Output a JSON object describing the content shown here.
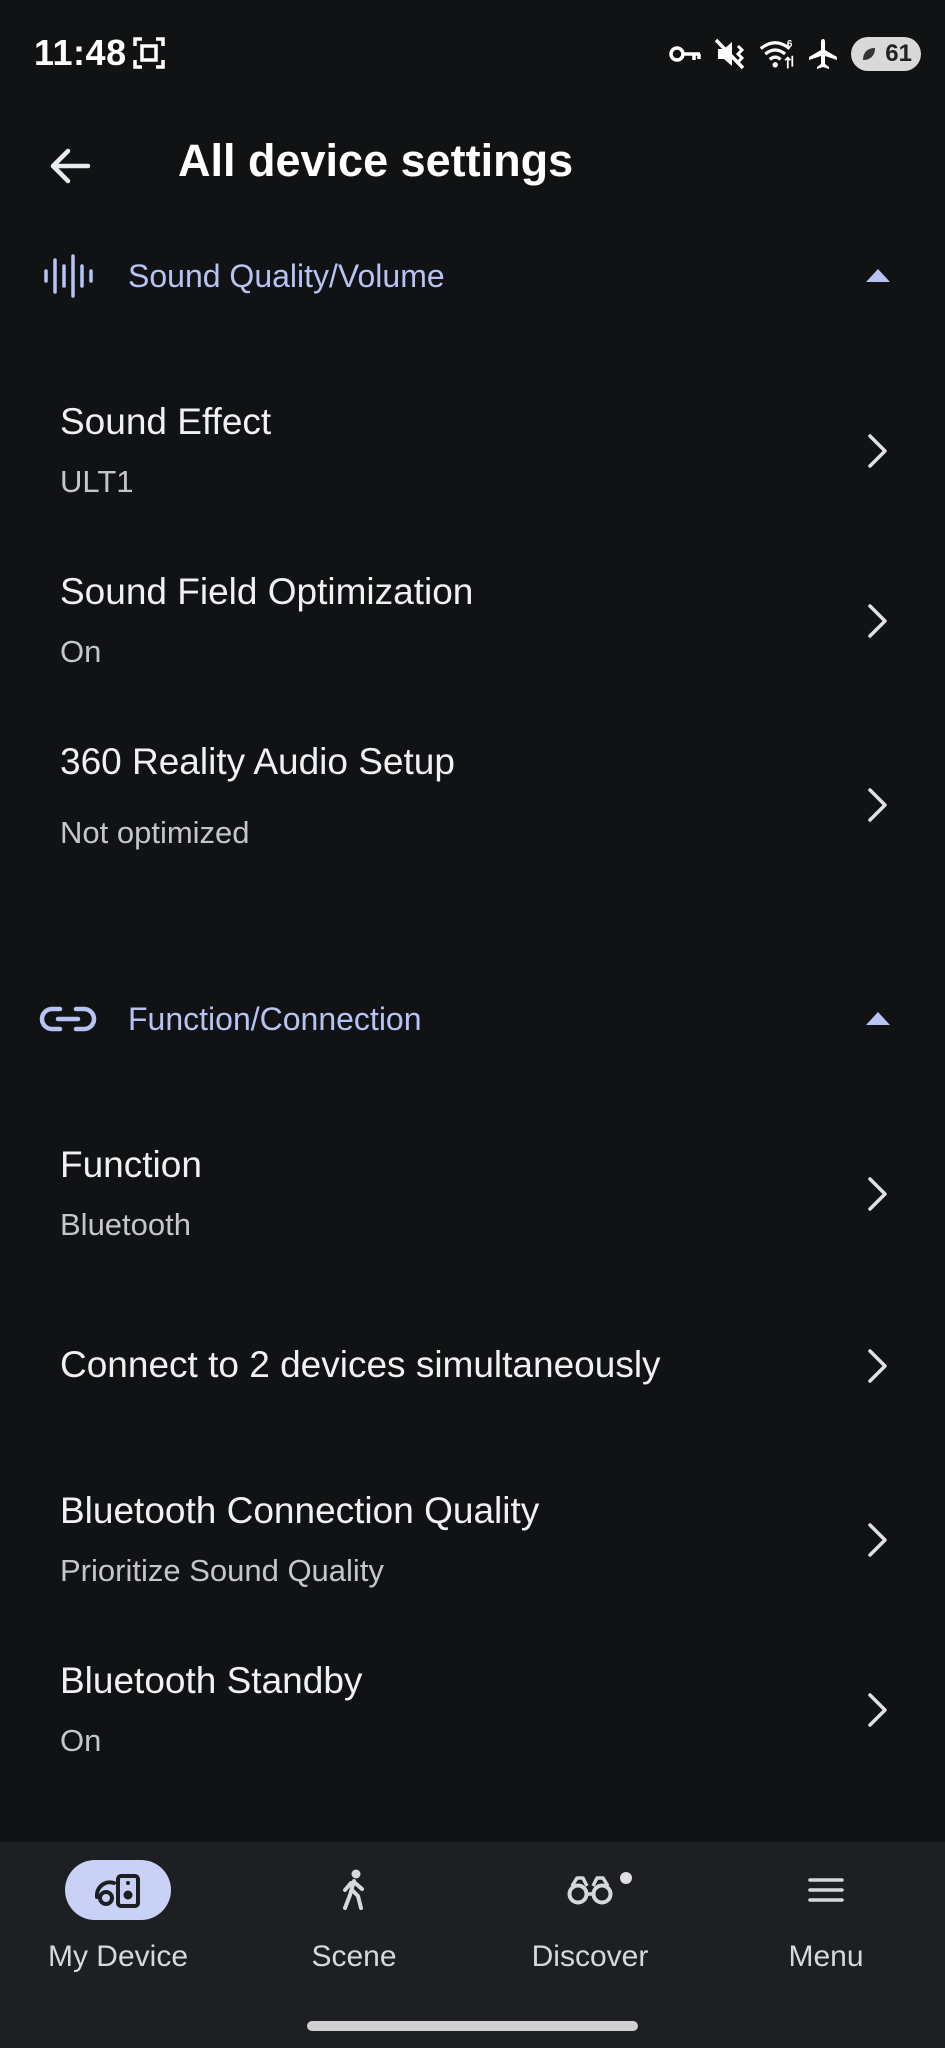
{
  "status_bar": {
    "time": "11:48",
    "battery_level": "61",
    "icons": [
      "screenshot-icon",
      "vpn-key-icon",
      "mute-vibrate-icon",
      "wifi-6-icon",
      "airplane-icon",
      "battery-icon"
    ]
  },
  "header": {
    "title": "All device settings",
    "back_icon": "arrow-left-icon"
  },
  "sections": [
    {
      "title": "Sound Quality/Volume",
      "icon": "sound-wave-icon",
      "expanded": true,
      "items": [
        {
          "title": "Sound Effect",
          "value": "ULT1"
        },
        {
          "title": "Sound Field Optimization",
          "value": "On"
        },
        {
          "title": "360 Reality Audio Setup",
          "value": "Not optimized"
        }
      ]
    },
    {
      "title": "Function/Connection",
      "icon": "link-icon",
      "expanded": true,
      "items": [
        {
          "title": "Function",
          "value": "Bluetooth"
        },
        {
          "title": "Connect to 2 devices simultaneously",
          "value": ""
        },
        {
          "title": "Bluetooth Connection Quality",
          "value": "Prioritize Sound Quality"
        },
        {
          "title": "Bluetooth Standby",
          "value": "On"
        }
      ]
    }
  ],
  "bottom_nav": {
    "items": [
      {
        "label": "My Device",
        "icon": "speaker-device-icon",
        "active": true
      },
      {
        "label": "Scene",
        "icon": "walking-person-icon",
        "active": false
      },
      {
        "label": "Discover",
        "icon": "binoculars-icon",
        "active": false,
        "badge_dot": true
      },
      {
        "label": "Menu",
        "icon": "hamburger-menu-icon",
        "active": false
      }
    ]
  },
  "colors": {
    "background": "#111213",
    "accent": "#b7c3f5",
    "nav_active_pill": "#c9d1f7",
    "nav_background": "#1d1f22"
  }
}
